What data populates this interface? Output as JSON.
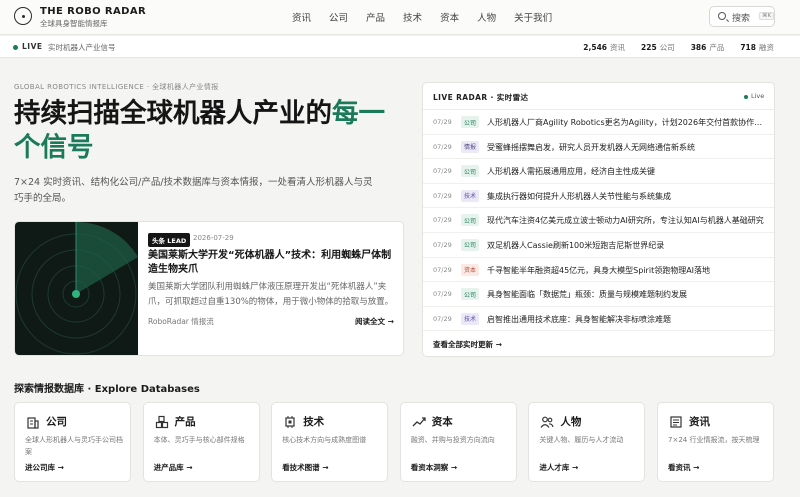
{
  "brand": {
    "title": "THE ROBO RADAR",
    "subtitle": "全球具身智能情报库"
  },
  "nav": {
    "items": [
      "资讯",
      "公司",
      "产品",
      "技术",
      "资本",
      "人物",
      "关于我们"
    ]
  },
  "search": {
    "label": "搜索",
    "shortcut": "⌘K"
  },
  "livebar": {
    "label": "LIVE",
    "text": "实时机器人产业信号",
    "stats": [
      {
        "value": "2,546",
        "label": "资讯"
      },
      {
        "value": "225",
        "label": "公司"
      },
      {
        "value": "386",
        "label": "产品"
      },
      {
        "value": "718",
        "label": "融资"
      }
    ]
  },
  "hero": {
    "eyebrow": "GLOBAL ROBOTICS INTELLIGENCE · 全球机器人产业情报",
    "title_main": "持续扫描全球机器人产业的",
    "title_accent": "每一个信号",
    "subtitle": "7×24 实时资讯、结构化公司/产品/技术数据库与资本情报，一处看清人形机器人与灵巧手的全局。"
  },
  "lead": {
    "badge": "头条 LEAD",
    "date": "2026-07-29",
    "title": "美国莱斯大学开发“死体机器人”技术：利用蜘蛛尸体制造生物夹爪",
    "excerpt": "美国莱斯大学团队利用蜘蛛尸体液压原理开发出“死体机器人”夹爪，可抓取超过自重130%的物体，用于微小物体的拾取与放置。",
    "source": "RoboRadar 情报流",
    "link": "阅读全文 →"
  },
  "radar": {
    "title": "LIVE RADAR · 实时雷达",
    "live": "Live",
    "footer": "查看全部实时更新 →",
    "items": [
      {
        "date": "07/29",
        "tag": "公司",
        "tag_type": "company",
        "text": "人形机器人厂商Agility Robotics更名为Agility，计划2026年交付首款协作机器人"
      },
      {
        "date": "07/29",
        "tag": "情报",
        "tag_type": "intel",
        "text": "受蜜蜂摇摆舞启发，研究人员开发机器人无网络通信新系统"
      },
      {
        "date": "07/29",
        "tag": "公司",
        "tag_type": "company",
        "text": "人形机器人需拓展通用应用，经济自主性成关键"
      },
      {
        "date": "07/29",
        "tag": "技术",
        "tag_type": "tech",
        "text": "集成执行器如何提升人形机器人关节性能与系统集成"
      },
      {
        "date": "07/29",
        "tag": "公司",
        "tag_type": "company",
        "text": "现代汽车注资4亿美元成立波士顿动力AI研究所，专注认知AI与机器人基础研究"
      },
      {
        "date": "07/29",
        "tag": "公司",
        "tag_type": "company",
        "text": "双足机器人Cassie刷新100米短跑吉尼斯世界纪录"
      },
      {
        "date": "07/29",
        "tag": "资本",
        "tag_type": "capital",
        "text": "千寻智能半年融资超45亿元，具身大模型Spirit领跑物理AI落地"
      },
      {
        "date": "07/29",
        "tag": "公司",
        "tag_type": "company",
        "text": "具身智能面临「数据荒」瓶颈：质量与规模难题制约发展"
      },
      {
        "date": "07/29",
        "tag": "技术",
        "tag_type": "tech",
        "text": "启智推出通用技术底座：具身智能解决非标喷涂难题"
      }
    ]
  },
  "databases": {
    "title": "探索情报数据库 · Explore Databases",
    "cards": [
      {
        "icon": "building-icon",
        "name": "公司",
        "desc": "全球人形机器人与灵巧手公司档案",
        "link": "进公司库 →"
      },
      {
        "icon": "cubes-icon",
        "name": "产品",
        "desc": "本体、灵巧手与核心部件规格",
        "link": "进产品库 →"
      },
      {
        "icon": "chip-icon",
        "name": "技术",
        "desc": "核心技术方向与成熟度图谱",
        "link": "看技术图谱 →"
      },
      {
        "icon": "trend-icon",
        "name": "资本",
        "desc": "融资、并购与投资方向流向",
        "link": "看资本洞察 →"
      },
      {
        "icon": "people-icon",
        "name": "人物",
        "desc": "关键人物、履历与人才流动",
        "link": "进人才库 →"
      },
      {
        "icon": "news-icon",
        "name": "资讯",
        "desc": "7×24 行业情报流，按天梳理",
        "link": "看资讯 →"
      }
    ]
  },
  "colors": {
    "accent": "#1a7a5a",
    "dark": "#151515",
    "background": "#f4f4f2"
  }
}
